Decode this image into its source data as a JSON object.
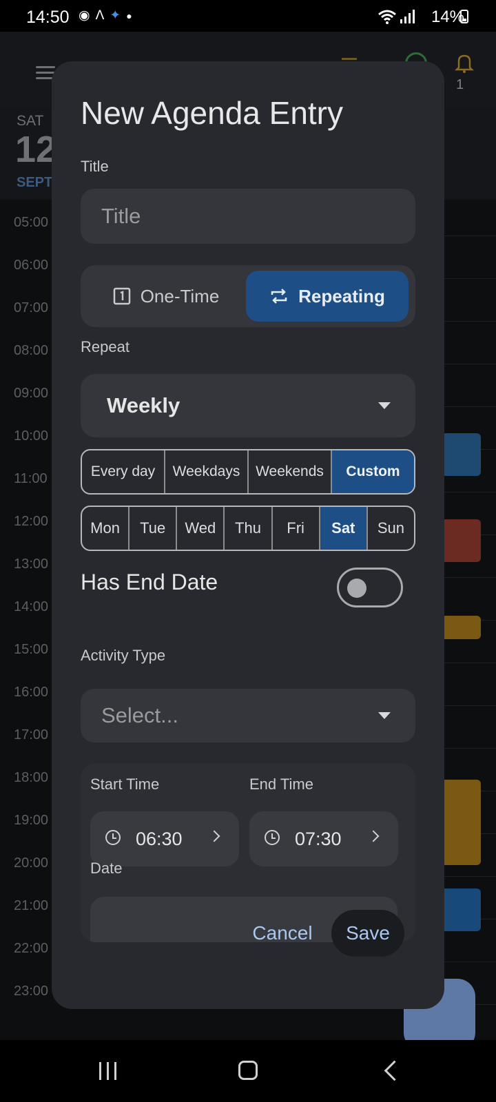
{
  "status_bar": {
    "time": "14:50",
    "battery_percent": "14%",
    "notification_icons": [
      "incognito-icon",
      "a-logo-icon",
      "sparkle-icon",
      "dot-icon"
    ]
  },
  "background": {
    "day_of_week": "SAT",
    "day_number": "12",
    "month": "SEPT",
    "bell_count": "1",
    "hours": [
      "05:00",
      "06:00",
      "07:00",
      "08:00",
      "09:00",
      "10:00",
      "11:00",
      "12:00",
      "13:00",
      "14:00",
      "15:00",
      "16:00",
      "17:00",
      "18:00",
      "19:00",
      "20:00",
      "21:00",
      "22:00",
      "23:00"
    ]
  },
  "dialog": {
    "title": "New Agenda Entry",
    "title_label": "Title",
    "title_placeholder": "Title",
    "mode": {
      "one_time": "One-Time",
      "repeating": "Repeating",
      "selected": "Repeating"
    },
    "repeat_label": "Repeat",
    "repeat_value": "Weekly",
    "presets": [
      "Every day",
      "Weekdays",
      "Weekends",
      "Custom"
    ],
    "preset_selected": "Custom",
    "days": [
      "Mon",
      "Tue",
      "Wed",
      "Thu",
      "Fri",
      "Sat",
      "Sun"
    ],
    "days_selected": [
      "Sat"
    ],
    "has_end_date_label": "Has End Date",
    "has_end_date": false,
    "activity_type_label": "Activity Type",
    "activity_type_placeholder": "Select...",
    "start_time_label": "Start Time",
    "start_time": "06:30",
    "end_time_label": "End Time",
    "end_time": "07:30",
    "date_label": "Date",
    "cancel": "Cancel",
    "save": "Save"
  },
  "colors": {
    "accent": "#1d4e86",
    "dialog_bg": "#27292e",
    "field_bg": "#34363b",
    "action_text": "#a8c8f0"
  }
}
